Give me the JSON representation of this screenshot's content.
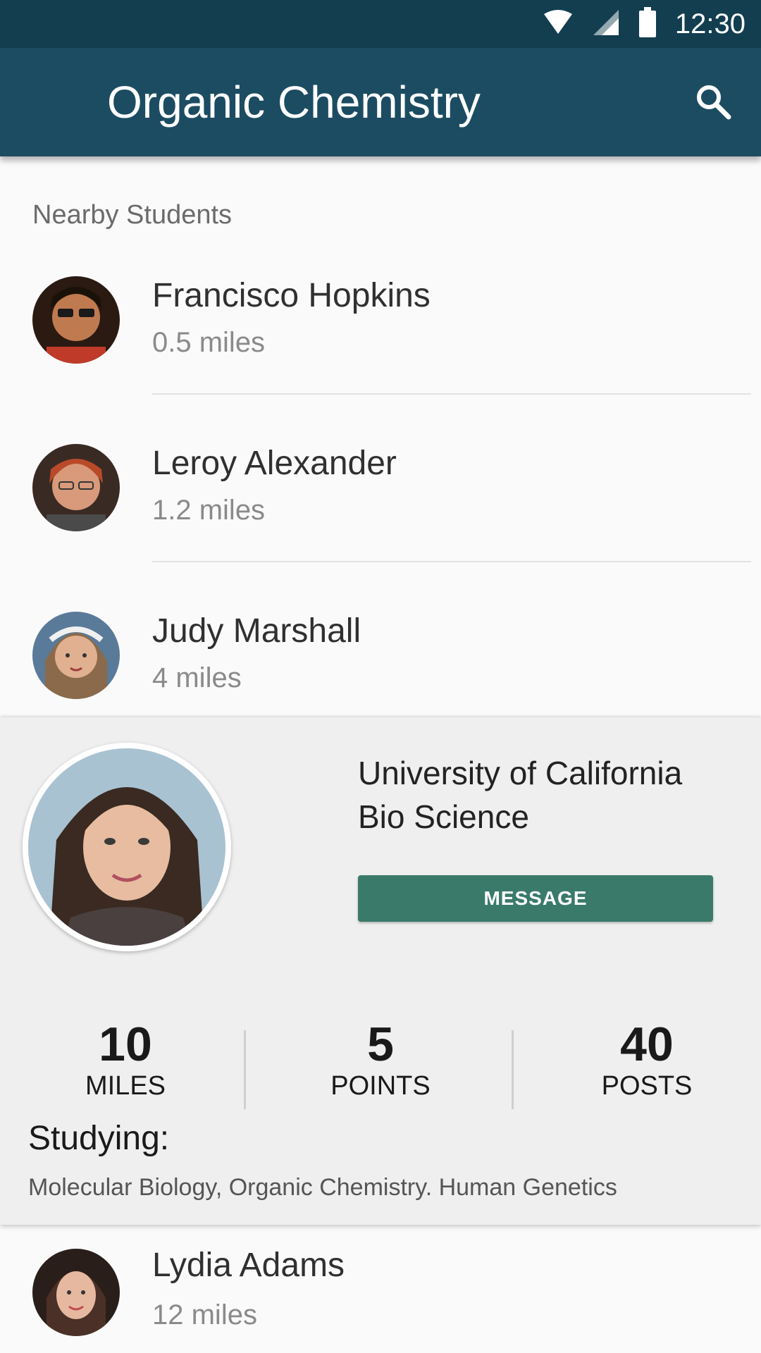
{
  "status_bar": {
    "time": "12:30",
    "icons": [
      "wifi-icon",
      "cell-signal-icon",
      "battery-icon"
    ]
  },
  "app_bar": {
    "title": "Organic Chemistry",
    "search_icon": "search-icon"
  },
  "nearby": {
    "header": "Nearby Students",
    "students": [
      {
        "name": "Francisco Hopkins",
        "distance": "0.5 miles",
        "avatar_color": "#8a4a2a"
      },
      {
        "name": "Leroy Alexander",
        "distance": "1.2 miles",
        "avatar_color": "#9a5a3a"
      },
      {
        "name": "Judy Marshall",
        "distance": "4 miles",
        "avatar_color": "#b0805a"
      }
    ]
  },
  "expanded": {
    "school_line1": "University of California",
    "school_line2": "Bio Science",
    "message_label": "MESSAGE",
    "stats": [
      {
        "value": "10",
        "label": "MILES"
      },
      {
        "value": "5",
        "label": "POINTS"
      },
      {
        "value": "40",
        "label": "POSTS"
      }
    ],
    "studying_label": "Studying:",
    "studying_subjects": "Molecular Biology, Organic Chemistry. Human Genetics"
  },
  "last_student": {
    "name": "Lydia Adams",
    "distance": "12 miles"
  },
  "colors": {
    "status_bar": "#123e50",
    "app_bar": "#1c4c62",
    "message_button": "#3a7a6a"
  }
}
